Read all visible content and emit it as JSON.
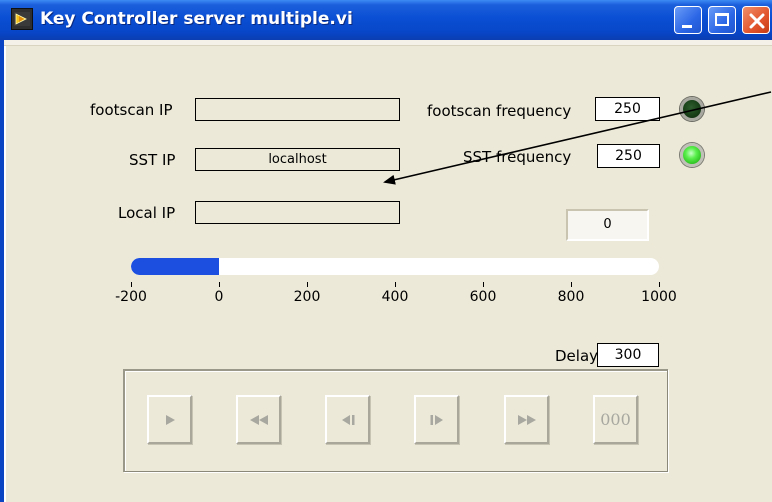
{
  "window": {
    "title": "Key Controller server multiple.vi",
    "icon": "labview-vi-icon",
    "controls": [
      "minimize-icon",
      "maximize-icon",
      "close-icon"
    ]
  },
  "fields": {
    "footscan_ip": {
      "label": "footscan IP",
      "value": ""
    },
    "sst_ip": {
      "label": "SST IP",
      "value": "localhost"
    },
    "local_ip": {
      "label": "Local IP",
      "value": ""
    }
  },
  "frequencies": {
    "footscan": {
      "label": "footscan frequency",
      "value": "250",
      "led_state": "off",
      "led_color": "#184018"
    },
    "sst": {
      "label": "SST frequency",
      "value": "250",
      "led_state": "on",
      "led_color": "#5cf04e"
    }
  },
  "counter": {
    "value": "0"
  },
  "slider": {
    "min": -200,
    "max": 1000,
    "value": 0,
    "ticks": [
      "-200",
      "0",
      "200",
      "400",
      "600",
      "800",
      "1000"
    ],
    "fill_color": "#1c4fe0"
  },
  "delay": {
    "label": "Delay",
    "value": "300"
  },
  "transport_buttons": [
    {
      "name": "play-button",
      "icon": "play-icon"
    },
    {
      "name": "rewind-button",
      "icon": "rewind-icon"
    },
    {
      "name": "step-back-button",
      "icon": "step-back-icon"
    },
    {
      "name": "step-forward-button",
      "icon": "step-forward-icon"
    },
    {
      "name": "fast-forward-button",
      "icon": "fast-forward-icon"
    },
    {
      "name": "reset-button",
      "label": "000"
    }
  ]
}
